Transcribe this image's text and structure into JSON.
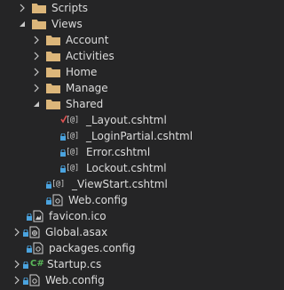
{
  "tree": {
    "scripts": {
      "label": "Scripts",
      "icon": "folder-icon"
    },
    "views": {
      "label": "Views",
      "icon": "folder-icon",
      "expanded": true
    },
    "account": {
      "label": "Account",
      "icon": "folder-icon"
    },
    "activities": {
      "label": "Activities",
      "icon": "folder-icon"
    },
    "home": {
      "label": "Home",
      "icon": "folder-icon"
    },
    "manage": {
      "label": "Manage",
      "icon": "folder-icon"
    },
    "shared": {
      "label": "Shared",
      "icon": "folder-icon",
      "expanded": true
    },
    "layout": {
      "label": "_Layout.cshtml",
      "icon": "razor-file-icon",
      "status": "checked-out"
    },
    "login_partial": {
      "label": "_LoginPartial.cshtml",
      "icon": "razor-file-icon",
      "status": "locked"
    },
    "error": {
      "label": "Error.cshtml",
      "icon": "razor-file-icon",
      "status": "locked"
    },
    "lockout": {
      "label": "Lockout.cshtml",
      "icon": "razor-file-icon",
      "status": "locked"
    },
    "viewstart": {
      "label": "_ViewStart.cshtml",
      "icon": "razor-file-icon",
      "status": "locked"
    },
    "views_webconfig": {
      "label": "Web.config",
      "icon": "config-file-icon",
      "status": "locked"
    },
    "favicon": {
      "label": "favicon.ico",
      "icon": "image-file-icon",
      "status": "locked"
    },
    "global": {
      "label": "Global.asax",
      "icon": "asax-file-icon",
      "status": "locked"
    },
    "packages": {
      "label": "packages.config",
      "icon": "config-file-icon",
      "status": "locked"
    },
    "startup": {
      "label": "Startup.cs",
      "icon": "csharp-file-icon",
      "status": "locked",
      "badge": "C#"
    },
    "webconfig": {
      "label": "Web.config",
      "icon": "config-file-icon",
      "status": "locked"
    }
  },
  "colors": {
    "background": "#252526",
    "text": "#dcdcdc",
    "folder": "#dcb67a",
    "lock": "#4aa3df",
    "checkmark": "#e05252",
    "csharp": "#5ab75a"
  }
}
